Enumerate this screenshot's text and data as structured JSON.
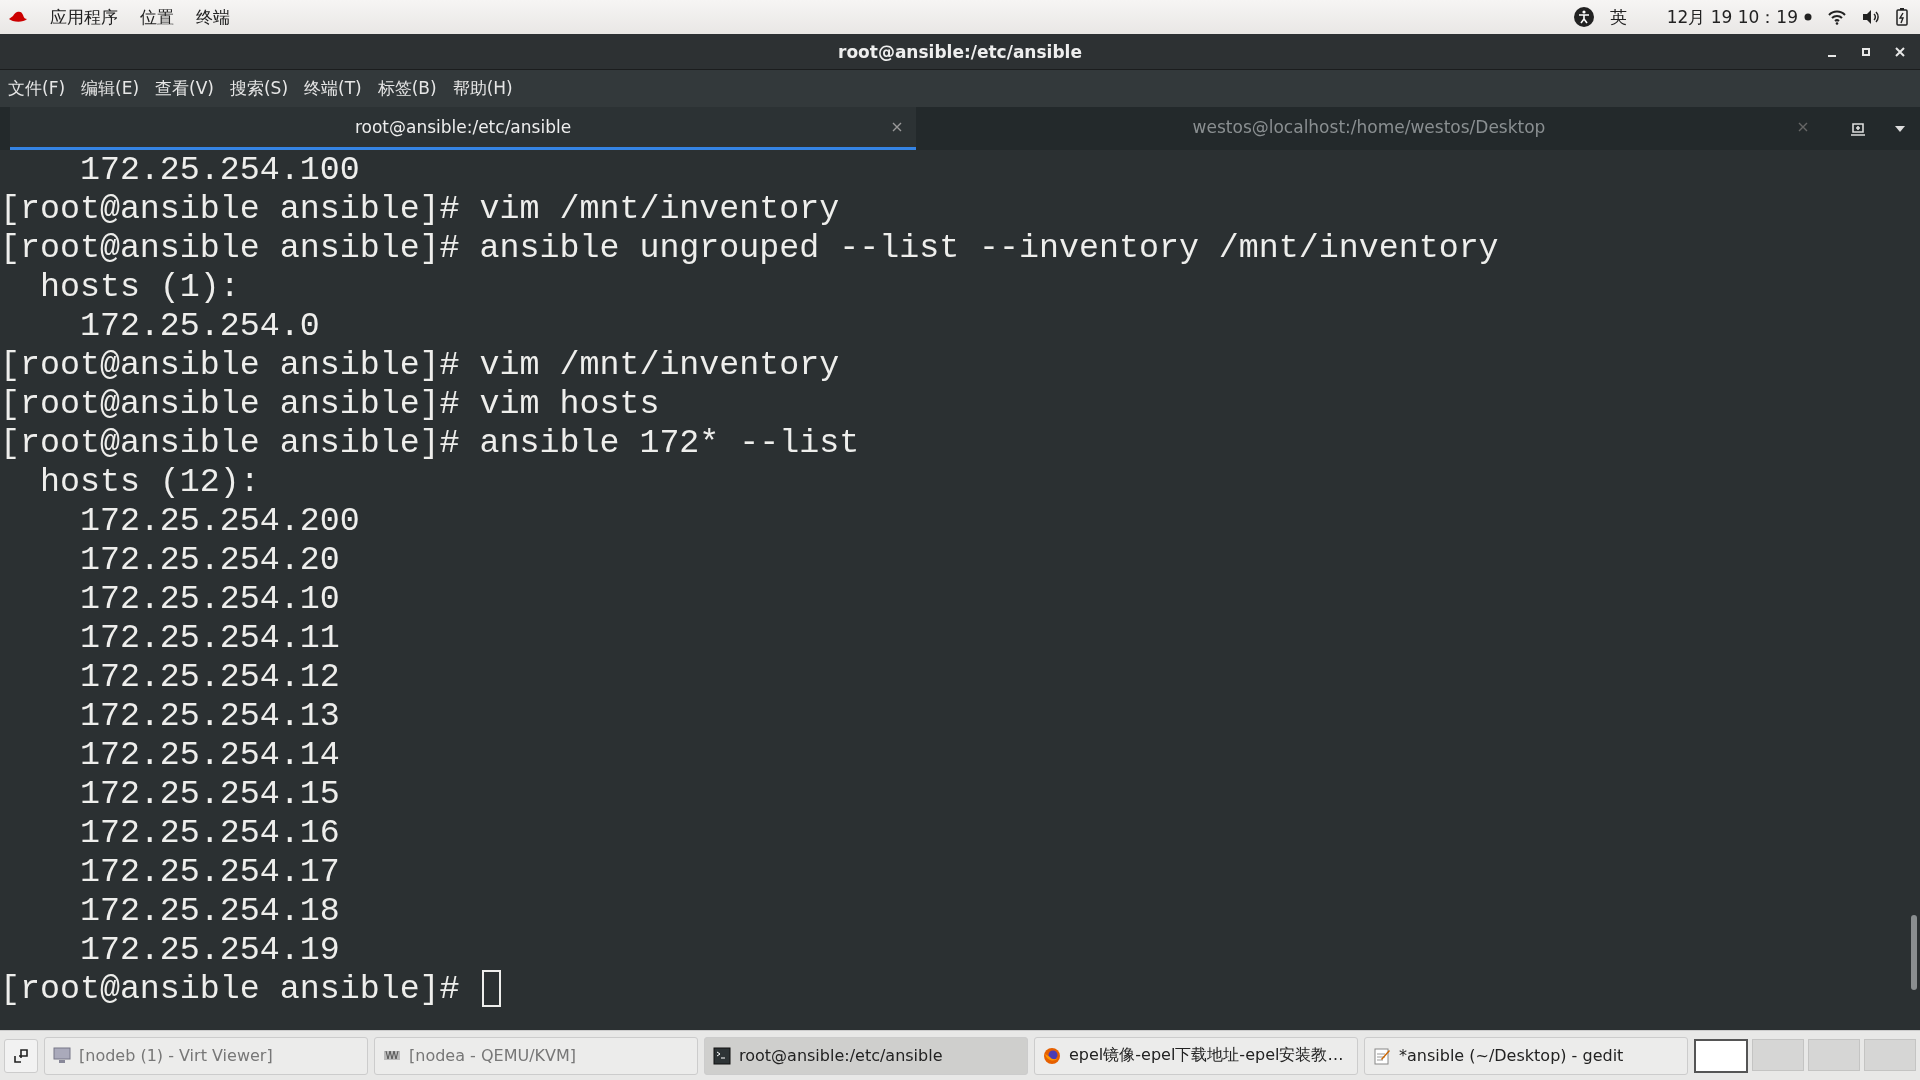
{
  "top_bar": {
    "menus": [
      "应用程序",
      "位置",
      "终端"
    ],
    "input_method": "英",
    "clock": "12月 19  10：19"
  },
  "window": {
    "title": "root@ansible:/etc/ansible"
  },
  "menu_bar": [
    "文件(F)",
    "编辑(E)",
    "查看(V)",
    "搜索(S)",
    "终端(T)",
    "标签(B)",
    "帮助(H)"
  ],
  "tabs": [
    {
      "label": "root@ansible:/etc/ansible",
      "selected": true
    },
    {
      "label": "westos@localhost:/home/westos/Desktop",
      "selected": false
    }
  ],
  "terminal": {
    "lines": [
      "    172.25.254.100",
      "[root@ansible ansible]# vim /mnt/inventory",
      "[root@ansible ansible]# ansible ungrouped --list --inventory /mnt/inventory",
      "  hosts (1):",
      "    172.25.254.0",
      "[root@ansible ansible]# vim /mnt/inventory",
      "[root@ansible ansible]# vim hosts",
      "[root@ansible ansible]# ansible 172* --list",
      "  hosts (12):",
      "    172.25.254.200",
      "    172.25.254.20",
      "    172.25.254.10",
      "    172.25.254.11",
      "    172.25.254.12",
      "    172.25.254.13",
      "    172.25.254.14",
      "    172.25.254.15",
      "    172.25.254.16",
      "    172.25.254.17",
      "    172.25.254.18",
      "    172.25.254.19",
      "[root@ansible ansible]# "
    ]
  },
  "taskbar": {
    "items": [
      {
        "label": "[nodeb (1) - Virt Viewer]",
        "kind": "monitor",
        "selected": false
      },
      {
        "label": "[nodea - QEMU/KVM]",
        "kind": "vm",
        "selected": false
      },
      {
        "label": "root@ansible:/etc/ansible",
        "kind": "terminal",
        "selected": true
      },
      {
        "label": "epel镜像-epel下载地址-epel安装教…",
        "kind": "browser",
        "selected": false
      },
      {
        "label": "*ansible (~/Desktop) - gedit",
        "kind": "editor",
        "selected": false
      }
    ],
    "workspaces": [
      {
        "selected": true
      },
      {
        "selected": false
      },
      {
        "selected": false
      },
      {
        "selected": false
      }
    ]
  }
}
